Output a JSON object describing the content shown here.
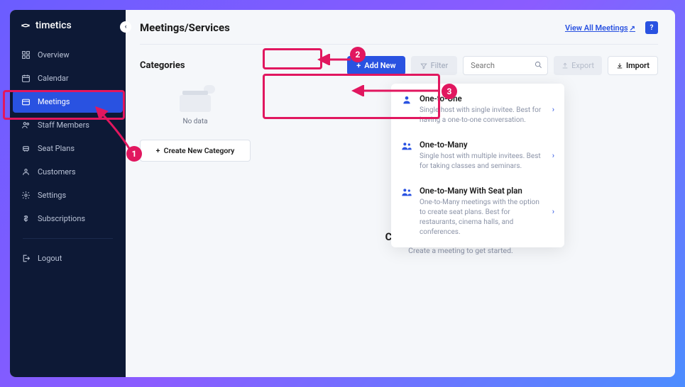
{
  "brand": {
    "name": "timetics"
  },
  "sidebar": {
    "items": [
      {
        "label": "Overview"
      },
      {
        "label": "Calendar"
      },
      {
        "label": "Meetings"
      },
      {
        "label": "Staff Members"
      },
      {
        "label": "Seat Plans"
      },
      {
        "label": "Customers"
      },
      {
        "label": "Settings"
      },
      {
        "label": "Subscriptions"
      }
    ],
    "logout": "Logout"
  },
  "header": {
    "title": "Meetings/Services",
    "view_all": "View All Meetings",
    "help": "?"
  },
  "toolbar": {
    "categories": "Categories",
    "add_new": "Add New",
    "filter": "Filter",
    "search_placeholder": "Search",
    "export": "Export",
    "import": "Import"
  },
  "categories": {
    "no_data": "No data",
    "create": "Create New Category"
  },
  "dropdown": [
    {
      "title": "One-to-One",
      "desc": "Single host with single invitee. Best for having a one-to-one conversation."
    },
    {
      "title": "One-to-Many",
      "desc": "Single host with multiple invitees. Best for taking classes and seminars."
    },
    {
      "title": "One-to-Many With Seat plan",
      "desc": "One-to-Many meetings with the option to create seat plans. Best for restaurants, cinema halls, and conferences."
    }
  ],
  "empty": {
    "title": "Currently, you have no meetings.",
    "sub": "Create a meeting to get started."
  },
  "annotations": {
    "n1": "1",
    "n2": "2",
    "n3": "3"
  }
}
